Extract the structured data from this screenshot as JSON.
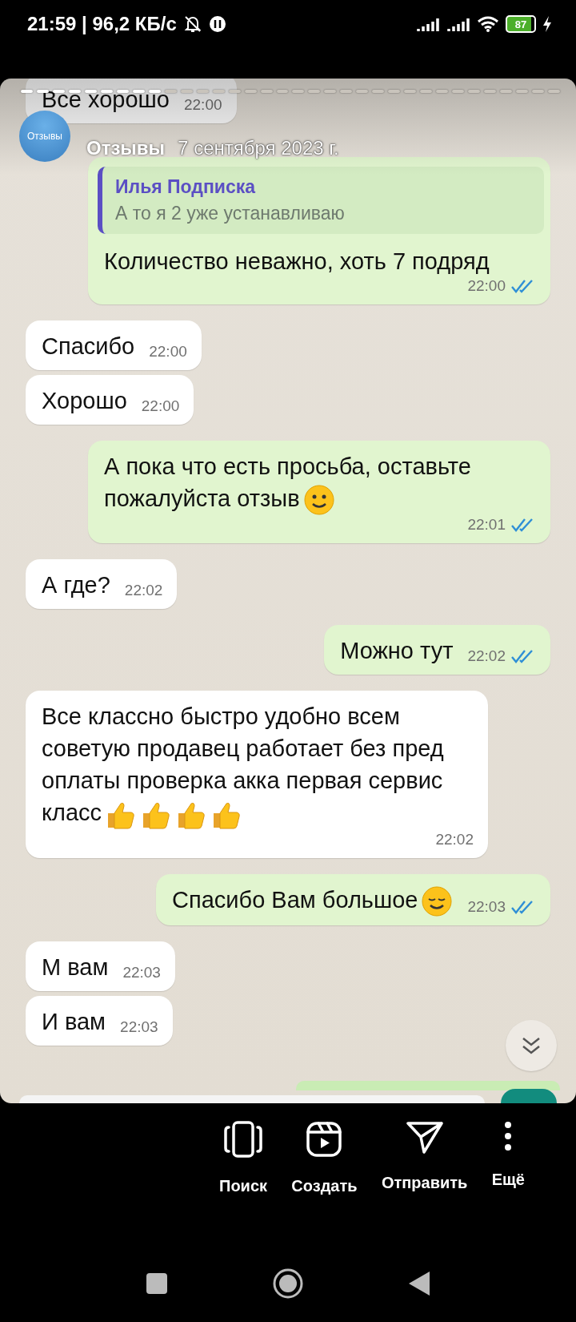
{
  "status_bar": {
    "time": "21:59 | 96,2 КБ/с",
    "battery": "87"
  },
  "story": {
    "progress": [
      {
        "viewed": true
      },
      {
        "viewed": true
      },
      {
        "viewed": true
      },
      {
        "viewed": true
      },
      {
        "viewed": true
      },
      {
        "viewed": true
      },
      {
        "viewed": true
      },
      {
        "viewed": true
      },
      {
        "viewed": true
      },
      {
        "viewed": false
      },
      {
        "viewed": false
      },
      {
        "viewed": false
      },
      {
        "viewed": false
      },
      {
        "viewed": false
      },
      {
        "viewed": false
      },
      {
        "viewed": false
      },
      {
        "viewed": false
      },
      {
        "viewed": false
      },
      {
        "viewed": false
      },
      {
        "viewed": false
      },
      {
        "viewed": false
      },
      {
        "viewed": false
      },
      {
        "viewed": false
      },
      {
        "viewed": false
      },
      {
        "viewed": false
      },
      {
        "viewed": false
      },
      {
        "viewed": false
      },
      {
        "viewed": false
      },
      {
        "viewed": false
      },
      {
        "viewed": false
      },
      {
        "viewed": false
      },
      {
        "viewed": false
      },
      {
        "viewed": false
      },
      {
        "viewed": false
      }
    ],
    "author": "Отзывы",
    "avatar_text": "Отзывы",
    "date": "7 сентября 2023 г."
  },
  "messages": [
    {
      "kind": "incoming",
      "text": "Все хорошо",
      "time": "22:00"
    },
    {
      "kind": "outgoing",
      "reply": {
        "name": "Илья Подписка",
        "text": "А то я 2 уже устанавливаю"
      },
      "text": "Количество неважно, хоть 7 подряд",
      "time": "22:00",
      "read": true
    },
    {
      "kind": "incoming",
      "text": "Спасибо",
      "time": "22:00"
    },
    {
      "kind": "incoming",
      "text": "Хорошо",
      "time": "22:00"
    },
    {
      "kind": "outgoing",
      "text": "А пока что есть просьба, оставьте пожалуйста отзыв",
      "emoji": [
        {
          "kind": "smile"
        }
      ],
      "time": "22:01",
      "read": true
    },
    {
      "kind": "incoming",
      "text": "А где?",
      "time": "22:02"
    },
    {
      "kind": "outgoing",
      "text": "Можно тут",
      "time": "22:02",
      "read": true
    },
    {
      "kind": "incoming",
      "text": "Все классно быстро удобно всем советую продавец работает без пред оплаты проверка акка первая сервис класс",
      "emoji": [
        {
          "kind": "thumbs_up"
        },
        {
          "kind": "thumbs_up"
        },
        {
          "kind": "thumbs_up"
        },
        {
          "kind": "thumbs_up"
        }
      ],
      "time": "22:02"
    },
    {
      "kind": "outgoing",
      "text": "Спасибо Вам большое",
      "emoji": [
        {
          "kind": "relieved"
        }
      ],
      "time": "22:03",
      "read": true
    },
    {
      "kind": "incoming",
      "text": "М вам",
      "time": "22:03"
    },
    {
      "kind": "incoming",
      "text": "И вам",
      "time": "22:03"
    }
  ],
  "actions": [
    {
      "kind": "phones",
      "label": "Поиск"
    },
    {
      "kind": "reels",
      "label": "Создать"
    },
    {
      "kind": "send",
      "label": "Отправить"
    },
    {
      "kind": "more",
      "label": "Ещё"
    }
  ]
}
